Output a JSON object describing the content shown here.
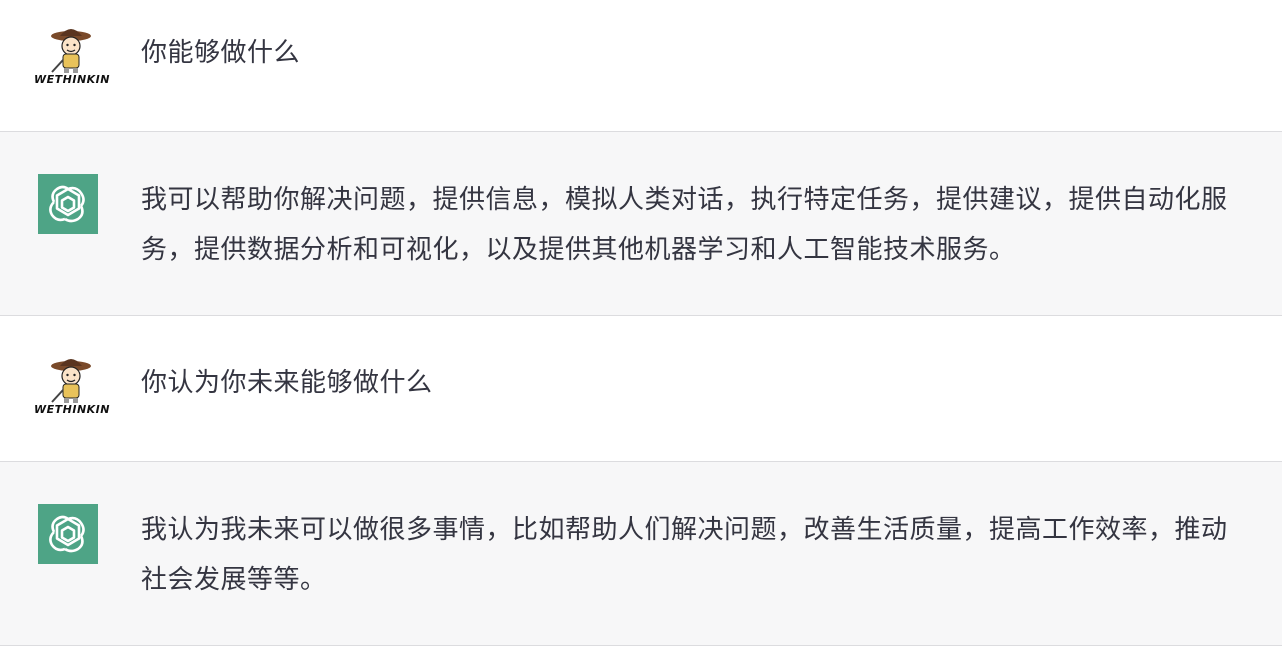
{
  "conversation": {
    "messages": [
      {
        "role": "user",
        "avatar_icon": "wethinkin-user-avatar",
        "avatar_caption": "WETHINKIN",
        "text": "你能够做什么"
      },
      {
        "role": "assistant",
        "avatar_icon": "openai-logo-icon",
        "text": "我可以帮助你解决问题，提供信息，模拟人类对话，执行特定任务，提供建议，提供自动化服务，提供数据分析和可视化，以及提供其他机器学习和人工智能技术服务。"
      },
      {
        "role": "user",
        "avatar_icon": "wethinkin-user-avatar",
        "avatar_caption": "WETHINKIN",
        "text": "你认为你未来能够做什么"
      },
      {
        "role": "assistant",
        "avatar_icon": "openai-logo-icon",
        "text": "我认为我未来可以做很多事情，比如帮助人们解决问题，改善生活质量，提高工作效率，推动社会发展等等。"
      }
    ]
  },
  "colors": {
    "assistant_bg": "#f7f7f8",
    "user_bg": "#ffffff",
    "bot_avatar_bg": "#4ea486",
    "text": "#343541",
    "divider": "#dcdcdf"
  }
}
